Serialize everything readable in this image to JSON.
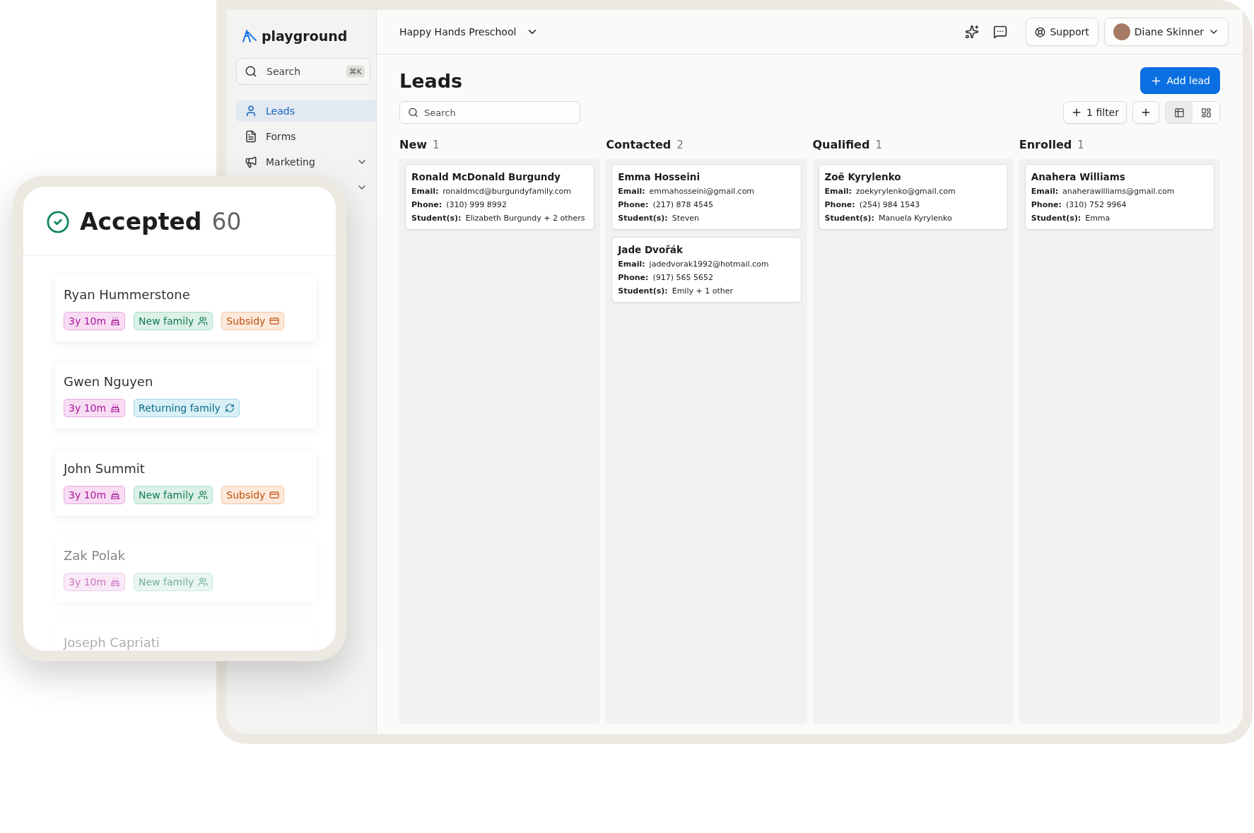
{
  "brand": {
    "name": "playground"
  },
  "sidebar": {
    "search": {
      "placeholder": "Search",
      "shortcut": "⌘K"
    },
    "items": [
      {
        "kind": "link",
        "label": "Leads",
        "selected": true
      },
      {
        "kind": "link",
        "label": "Forms",
        "selected": false
      },
      {
        "kind": "link",
        "label": "Marketing",
        "selected": false,
        "expanded": false
      },
      {
        "kind": "covered",
        "expanded": false
      }
    ]
  },
  "topbar": {
    "school": "Happy Hands Preschool",
    "support": "Support",
    "user": "Diane Skinner"
  },
  "page": {
    "title": "Leads",
    "add_button": "Add lead",
    "search_placeholder": "Search",
    "filter_button": "1 filter",
    "views": [
      {
        "kind": "list",
        "selected": true
      },
      {
        "kind": "board",
        "selected": false
      }
    ]
  },
  "columns": [
    {
      "name": "New",
      "count": "1",
      "cards": [
        {
          "name": "Ronald McDonald Burgundy",
          "fields": [
            {
              "label": "Email:",
              "value": "ronaldmcd@burgundyfamily.com"
            },
            {
              "label": "Phone:",
              "value": "(310) 999 8992"
            },
            {
              "label": "Student(s):",
              "value": "Elizabeth Burgundy + 2 others"
            }
          ]
        }
      ]
    },
    {
      "name": "Contacted",
      "count": "2",
      "cards": [
        {
          "name": "Emma Hosseini",
          "fields": [
            {
              "label": "Email:",
              "value": "emmahosseini@gmail.com"
            },
            {
              "label": "Phone:",
              "value": "(217) 878 4545"
            },
            {
              "label": "Student(s):",
              "value": "Steven"
            }
          ]
        },
        {
          "name": "Jade Dvořák",
          "fields": [
            {
              "label": "Email:",
              "value": "jadedvorak1992@hotmail.com"
            },
            {
              "label": "Phone:",
              "value": "(917) 565 5652"
            },
            {
              "label": "Student(s):",
              "value": "Emily + 1 other"
            }
          ]
        }
      ]
    },
    {
      "name": "Qualified",
      "count": "1",
      "cards": [
        {
          "name": "Zoë Kyrylenko",
          "fields": [
            {
              "label": "Email:",
              "value": "zoekyrylenko@gmail.com"
            },
            {
              "label": "Phone:",
              "value": "(254) 984 1543"
            },
            {
              "label": "Student(s):",
              "value": "Manuela Kyrylenko"
            }
          ]
        }
      ]
    },
    {
      "name": "Enrolled",
      "count": "1",
      "cards": [
        {
          "name": "Anahera Williams",
          "fields": [
            {
              "label": "Email:",
              "value": "anaherawilliams@gmail.com"
            },
            {
              "label": "Phone:",
              "value": "(310) 752 9964"
            },
            {
              "label": "Student(s):",
              "value": "Emma"
            }
          ]
        }
      ]
    }
  ],
  "accepted": {
    "title": "Accepted",
    "count": "60",
    "leads": [
      {
        "name": "Ryan Hummerstone",
        "tags": [
          {
            "kind": "age",
            "label": "3y 10m"
          },
          {
            "kind": "new",
            "label": "New family"
          },
          {
            "kind": "subsidy",
            "label": "Subsidy"
          }
        ]
      },
      {
        "name": "Gwen Nguyen",
        "tags": [
          {
            "kind": "age",
            "label": "3y 10m"
          },
          {
            "kind": "returning",
            "label": "Returning family"
          }
        ]
      },
      {
        "name": "John Summit",
        "tags": [
          {
            "kind": "age",
            "label": "3y 10m"
          },
          {
            "kind": "new",
            "label": "New family"
          },
          {
            "kind": "subsidy",
            "label": "Subsidy"
          }
        ]
      },
      {
        "name": "Zak Polak",
        "tags": [
          {
            "kind": "age",
            "label": "3y 10m"
          },
          {
            "kind": "new",
            "label": "New family"
          }
        ]
      },
      {
        "name": "Joseph Capriati"
      }
    ]
  }
}
